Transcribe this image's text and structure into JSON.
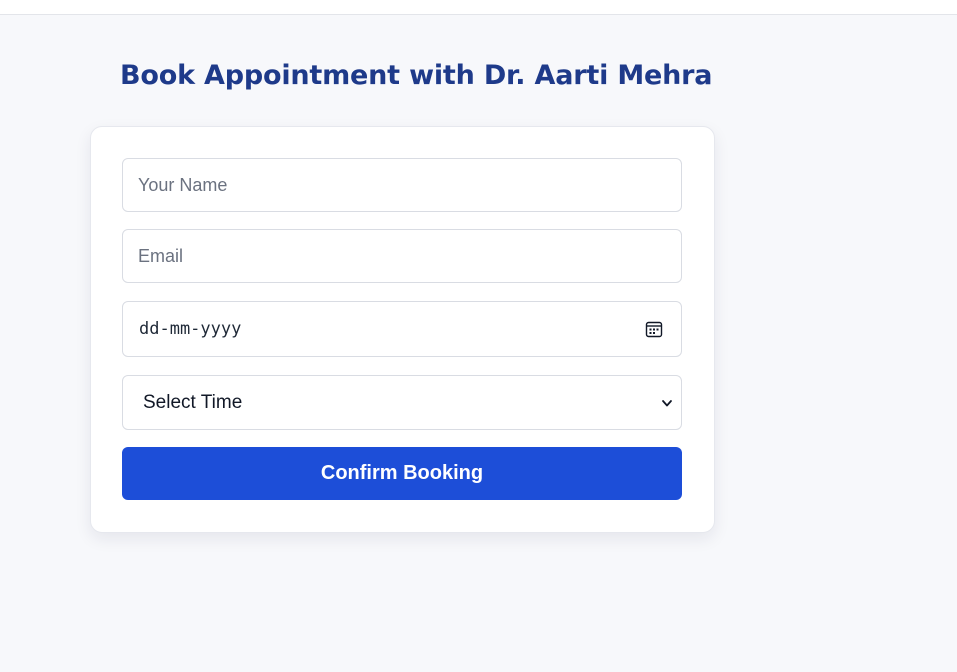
{
  "header": {
    "title": "Book Appointment with Dr. Aarti Mehra"
  },
  "form": {
    "name": {
      "placeholder": "Your Name",
      "value": ""
    },
    "email": {
      "placeholder": "Email",
      "value": ""
    },
    "date": {
      "display": "dd-mm-yyyy",
      "icon": "calendar-icon"
    },
    "time": {
      "selected": "Select Time",
      "icon": "chevron-down-icon"
    },
    "submit_label": "Confirm Booking"
  },
  "colors": {
    "background": "#f7f8fb",
    "title": "#1e3a8a",
    "button": "#1d4ed8",
    "button_text": "#ffffff"
  }
}
